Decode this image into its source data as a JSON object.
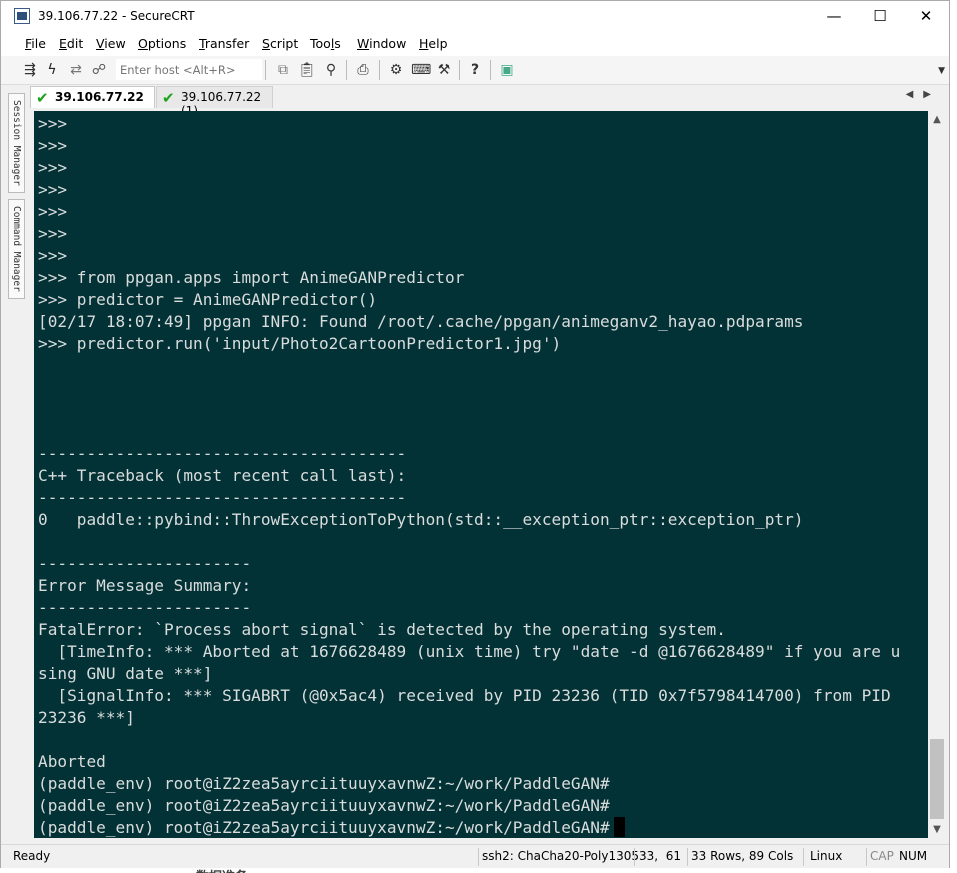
{
  "window": {
    "title": "39.106.77.22 - SecureCRT",
    "controls": {
      "minimize": "—",
      "maximize": "☐",
      "close": "✕"
    }
  },
  "menu": [
    {
      "label": "File",
      "u": "F",
      "rest": "ile"
    },
    {
      "label": "Edit",
      "u": "E",
      "rest": "dit"
    },
    {
      "label": "View",
      "u": "V",
      "rest": "iew"
    },
    {
      "label": "Options",
      "u": "O",
      "rest": "ptions"
    },
    {
      "label": "Transfer",
      "u": "T",
      "rest": "ransfer"
    },
    {
      "label": "Script",
      "u": "S",
      "rest": "cript"
    },
    {
      "label": "Tools",
      "pre": "Too",
      "u": "l",
      "rest": "s"
    },
    {
      "label": "Window",
      "u": "W",
      "rest": "indow"
    },
    {
      "label": "Help",
      "u": "H",
      "rest": "elp"
    }
  ],
  "toolbar": {
    "host_placeholder": "Enter host <Alt+R>",
    "icons": [
      "connect-icon",
      "quick-connect-icon",
      "reconnect-icon",
      "disconnect-icon",
      "copy-icon",
      "paste-icon",
      "find-icon",
      "print-icon",
      "settings-icon",
      "keymap-icon",
      "sftp-icon",
      "help-icon",
      "scriptlog-icon"
    ]
  },
  "tabs": [
    {
      "label": "39.106.77.22",
      "active": true,
      "close": "✕"
    },
    {
      "label": "39.106.77.22 (1)",
      "active": false
    }
  ],
  "side_panel": {
    "session_manager": "Session Manager",
    "command_manager": "Command Manager"
  },
  "terminal": {
    "lines": [
      ">>>",
      ">>>",
      ">>>",
      ">>>",
      ">>>",
      ">>>",
      ">>>",
      ">>> from ppgan.apps import AnimeGANPredictor",
      ">>> predictor = AnimeGANPredictor()",
      "[02/17 18:07:49] ppgan INFO: Found /root/.cache/ppgan/animeganv2_hayao.pdparams",
      ">>> predictor.run('input/Photo2CartoonPredictor1.jpg')",
      "",
      "",
      "",
      "",
      "--------------------------------------",
      "C++ Traceback (most recent call last):",
      "--------------------------------------",
      "0   paddle::pybind::ThrowExceptionToPython(std::__exception_ptr::exception_ptr)",
      "",
      "----------------------",
      "Error Message Summary:",
      "----------------------",
      "FatalError: `Process abort signal` is detected by the operating system.",
      "  [TimeInfo: *** Aborted at 1676628489 (unix time) try \"date -d @1676628489\" if you are u",
      "sing GNU date ***]",
      "  [SignalInfo: *** SIGABRT (@0x5ac4) received by PID 23236 (TID 0x7f5798414700) from PID",
      "23236 ***]",
      "",
      "Aborted",
      "(paddle_env) root@iZ2zea5ayrciituuyxavnwZ:~/work/PaddleGAN#",
      "(paddle_env) root@iZ2zea5ayrciituuyxavnwZ:~/work/PaddleGAN#",
      "(paddle_env) root@iZ2zea5ayrciituuyxavnwZ:~/work/PaddleGAN#"
    ],
    "background": "#033236",
    "foreground": "#d9dcdc"
  },
  "status": {
    "ready": "Ready",
    "cipher": "ssh2: ChaCha20-Poly1305",
    "position": "33,  61",
    "size": "33 Rows, 89 Cols",
    "os": "Linux",
    "cap": "CAP",
    "num": "NUM"
  },
  "background_fragments": {
    "below_window": "数据准备"
  }
}
